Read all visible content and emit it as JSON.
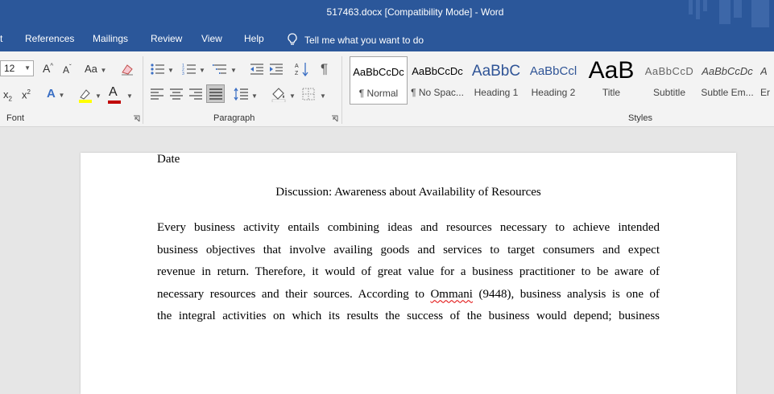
{
  "window": {
    "title": "517463.docx [Compatibility Mode]  -  Word"
  },
  "tabs": [
    {
      "label": "t"
    },
    {
      "label": "References"
    },
    {
      "label": "Mailings"
    },
    {
      "label": "Review"
    },
    {
      "label": "View"
    },
    {
      "label": "Help"
    }
  ],
  "tell_me": {
    "label": "Tell me what you want to do"
  },
  "font_group": {
    "label": "Font",
    "size_value": "12",
    "grow_label": "A",
    "shrink_label": "A",
    "change_case_label": "Aa",
    "subscript_label": "x",
    "superscript_label": "x",
    "highlight_color": "#ffff00",
    "font_color": "#c00000"
  },
  "paragraph_group": {
    "label": "Paragraph",
    "justify_active": true
  },
  "styles_group": {
    "label": "Styles",
    "items": [
      {
        "sample": "AaBbCcDc",
        "name": "¶ Normal",
        "selected": true
      },
      {
        "sample": "AaBbCcDc",
        "name": "¶ No Spac..."
      },
      {
        "sample": "AaBbC",
        "name": "Heading 1"
      },
      {
        "sample": "AaBbCcl",
        "name": "Heading 2"
      },
      {
        "sample": "AaB",
        "name": "Title"
      },
      {
        "sample": "AaBbCcD",
        "name": "Subtitle"
      },
      {
        "sample": "AaBbCcDc",
        "name": "Subtle Em..."
      },
      {
        "sample": "A",
        "name": "Er"
      }
    ]
  },
  "document": {
    "date": "Date",
    "heading": "Discussion: Awareness about Availability of Resources",
    "lines": [
      "Every business activity entails combining ideas and resources necessary to achieve intended",
      "business objectives that involve availing goods and services to target consumers and expect",
      "revenue in return. Therefore, it would of great value for a business practitioner to be aware of",
      "necessary resources and their sources. According to",
      "the integral activities on which its results the success of the business would depend; business"
    ],
    "line4_misspelled": "Ommani",
    "line4_tail": "(9448), business analysis is one of"
  },
  "colors": {
    "brand": "#2b579a",
    "ribbon_bg": "#f3f3f3",
    "canvas_bg": "#e6e6e6"
  }
}
